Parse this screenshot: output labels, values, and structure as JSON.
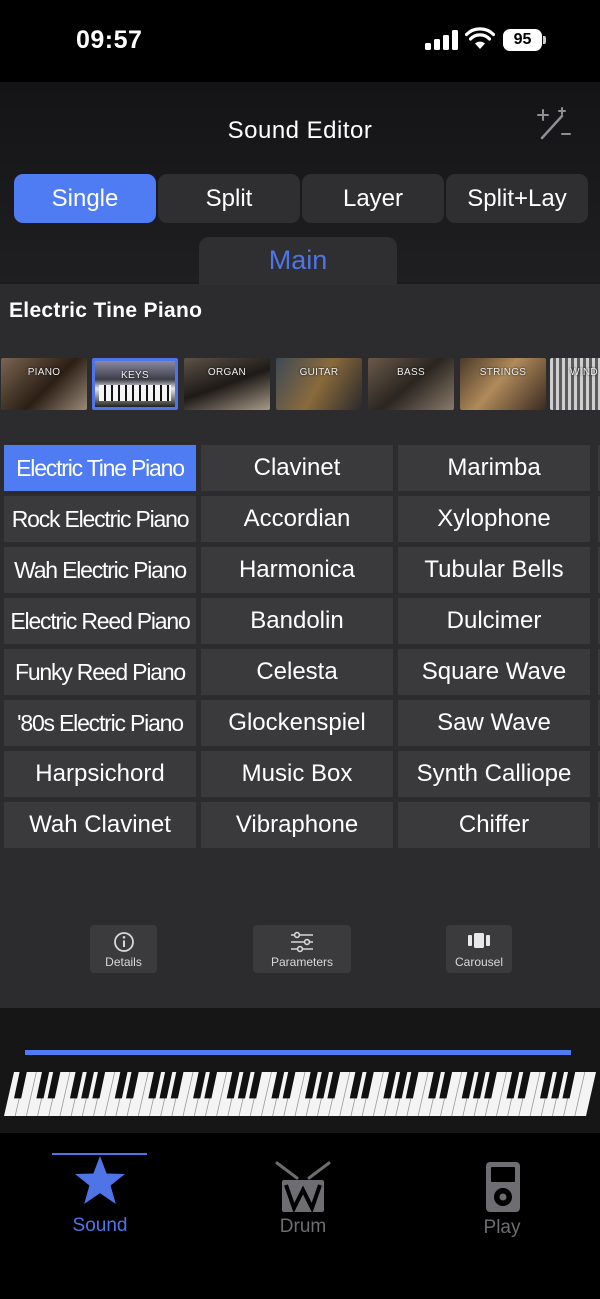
{
  "status_bar": {
    "time": "09:57",
    "battery": "95"
  },
  "header": {
    "title": "Sound Editor"
  },
  "mode_tabs": [
    {
      "label": "Single",
      "active": true
    },
    {
      "label": "Split",
      "active": false
    },
    {
      "label": "Layer",
      "active": false
    },
    {
      "label": "Split+Lay",
      "active": false
    }
  ],
  "main_tab": {
    "label": "Main"
  },
  "current_sound": "Electric Tine Piano",
  "categories": [
    {
      "label": "PIANO",
      "active": false
    },
    {
      "label": "KEYS",
      "active": true
    },
    {
      "label": "ORGAN",
      "active": false
    },
    {
      "label": "GUITAR",
      "active": false
    },
    {
      "label": "BASS",
      "active": false
    },
    {
      "label": "STRINGS",
      "active": false
    },
    {
      "label": "WIND",
      "active": false
    }
  ],
  "sounds": [
    [
      "Electric Tine Piano",
      "Clavinet",
      "Marimba"
    ],
    [
      "Rock Electric Piano",
      "Accordian",
      "Xylophone"
    ],
    [
      "Wah Electric Piano",
      "Harmonica",
      "Tubular Bells"
    ],
    [
      "Electric Reed Piano",
      "Bandolin",
      "Dulcimer"
    ],
    [
      "Funky Reed Piano",
      "Celesta",
      "Square Wave"
    ],
    [
      "'80s Electric Piano",
      "Glockenspiel",
      "Saw Wave"
    ],
    [
      "Harpsichord",
      "Music Box",
      "Synth Calliope"
    ],
    [
      "Wah Clavinet",
      "Vibraphone",
      "Chiffer"
    ]
  ],
  "tools": {
    "details": "Details",
    "parameters": "Parameters",
    "carousel": "Carousel"
  },
  "tabbar": {
    "sound": "Sound",
    "drum": "Drum",
    "play": "Play"
  },
  "colors": {
    "accent": "#4f7cf3",
    "panel": "#2c2c2e",
    "cell": "#3a3a3c"
  }
}
